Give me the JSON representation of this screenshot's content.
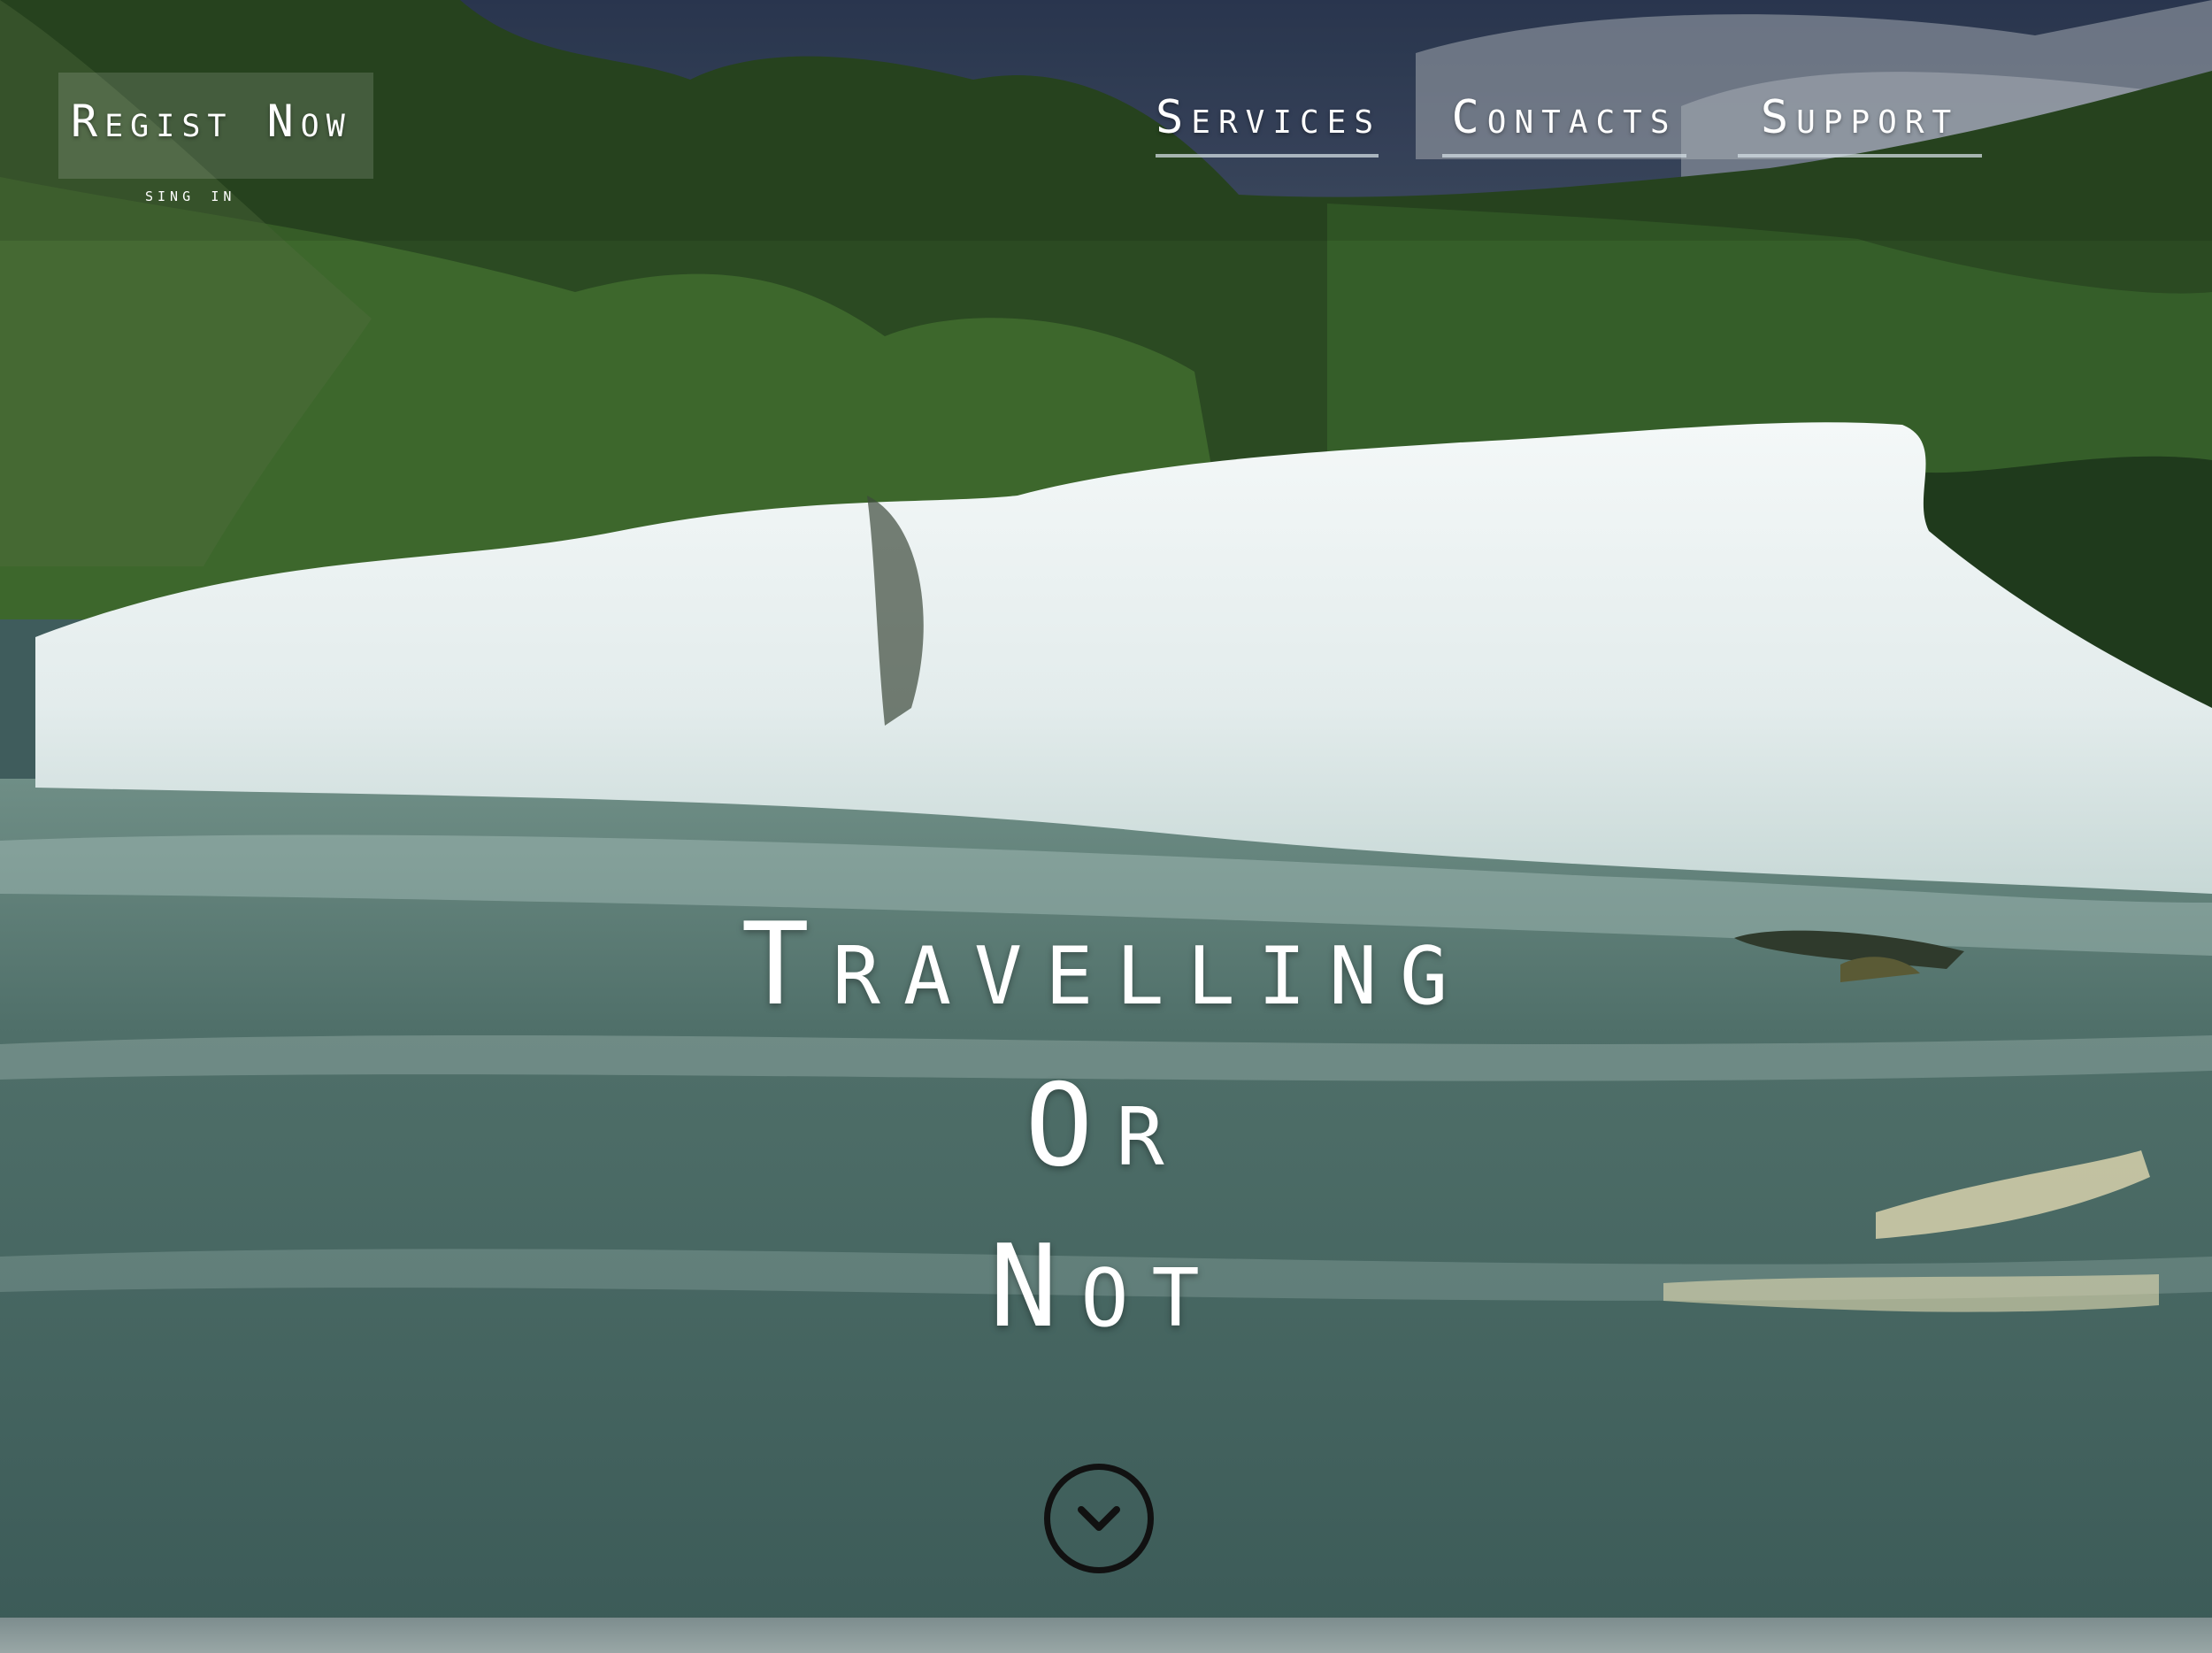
{
  "brand": {
    "title": "Regist Now",
    "signin": "sing in"
  },
  "nav": {
    "services": "Services",
    "contacts": "Contacts",
    "support": "Support"
  },
  "hero": {
    "line1": "Travelling",
    "line2": "Or",
    "line3": "Not"
  },
  "icons": {
    "scroll": "chevron-down-circle-icon"
  },
  "colors": {
    "text": "#ffffff",
    "nav_underline": "#d2dce1",
    "scroll_button": "#111111"
  }
}
